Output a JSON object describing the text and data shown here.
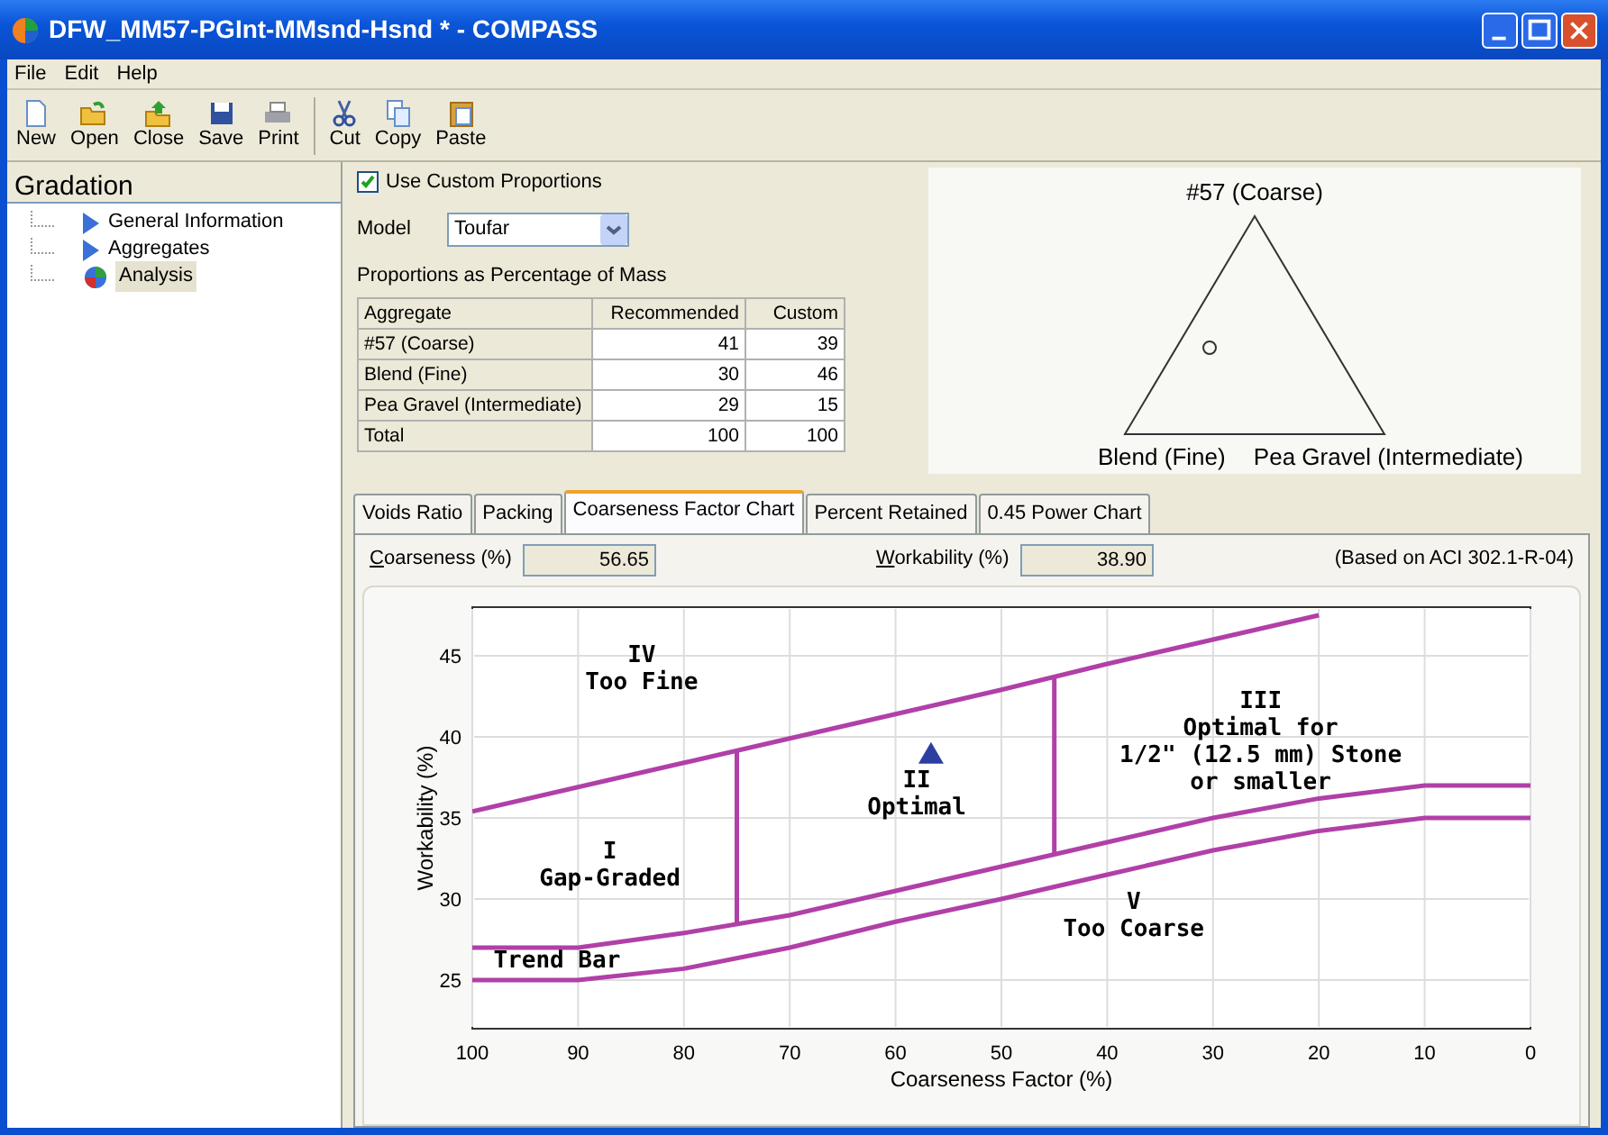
{
  "window": {
    "title": "DFW_MM57-PGInt-MMsnd-Hsnd * - COMPASS"
  },
  "menu": [
    "File",
    "Edit",
    "Help"
  ],
  "toolbar": [
    {
      "label": "New"
    },
    {
      "label": "Open"
    },
    {
      "label": "Close"
    },
    {
      "label": "Save"
    },
    {
      "label": "Print"
    },
    {
      "label": "Cut"
    },
    {
      "label": "Copy"
    },
    {
      "label": "Paste"
    }
  ],
  "sidebar": {
    "title": "Gradation",
    "items": [
      {
        "label": "General Information",
        "selected": false
      },
      {
        "label": "Aggregates",
        "selected": false
      },
      {
        "label": "Analysis",
        "selected": true
      }
    ]
  },
  "proportions": {
    "use_custom": {
      "label": "Use Custom Proportions",
      "checked": true
    },
    "model": {
      "label": "Model",
      "value": "Toufar"
    },
    "caption": "Proportions as Percentage of Mass",
    "columns": [
      "Aggregate",
      "Recommended",
      "Custom"
    ],
    "rows": [
      [
        "#57 (Coarse)",
        "41",
        "39"
      ],
      [
        "Blend (Fine)",
        "30",
        "46"
      ],
      [
        "Pea Gravel (Intermediate)",
        "29",
        "15"
      ],
      [
        "Total",
        "100",
        "100"
      ]
    ]
  },
  "ternary": {
    "top": "#57 (Coarse)",
    "left": "Blend (Fine)",
    "right": "Pea Gravel (Intermediate)"
  },
  "tabs": [
    {
      "label": "Voids Ratio",
      "selected": false
    },
    {
      "label": "Packing",
      "selected": false
    },
    {
      "label": "Coarseness Factor Chart",
      "selected": true
    },
    {
      "label": "Percent Retained",
      "selected": false
    },
    {
      "label": "0.45 Power Chart",
      "selected": false
    }
  ],
  "readouts": [
    {
      "label": "Coarseness (%)",
      "value": "56.65"
    },
    {
      "label": "Workability (%)",
      "value": "38.90"
    }
  ],
  "note": "(Based on ACI 302.1-R-04)",
  "chart_data": {
    "type": "line",
    "grid": true,
    "xlabel": "Coarseness Factor (%)",
    "ylabel": "Workability (%)",
    "xlim": [
      100,
      0
    ],
    "ylim": [
      22,
      48
    ],
    "xticks": [
      100,
      90,
      80,
      70,
      60,
      50,
      40,
      30,
      20,
      10,
      0
    ],
    "yticks": [
      25,
      30,
      35,
      40,
      45
    ],
    "x": [
      100,
      90,
      80,
      70,
      60,
      50,
      40,
      30,
      20,
      10,
      0
    ],
    "series": [
      {
        "color": "#b040a8",
        "values": [
          35.4,
          36.9,
          38.4,
          39.9,
          41.4,
          42.9,
          44.5,
          46.0,
          47.5,
          null,
          null
        ]
      },
      {
        "color": "#b040a8",
        "values": [
          27,
          27,
          27.9,
          29,
          30.5,
          32,
          33.5,
          35,
          36.2,
          37,
          37
        ]
      },
      {
        "color": "#b040a8",
        "values": [
          25,
          25,
          25.7,
          27,
          28.6,
          30,
          31.5,
          33,
          34.2,
          35,
          35
        ]
      }
    ],
    "annotations": [
      {
        "text": "IV\nToo Fine"
      },
      {
        "text": "II\nOptimal"
      },
      {
        "text": "III\nOptimal for\n1/2\" (12.5 mm) Stone\nor smaller"
      },
      {
        "text": "I\nGap-Graded"
      },
      {
        "text": "V\nToo Coarse"
      },
      {
        "text": "Trend Bar"
      }
    ]
  }
}
